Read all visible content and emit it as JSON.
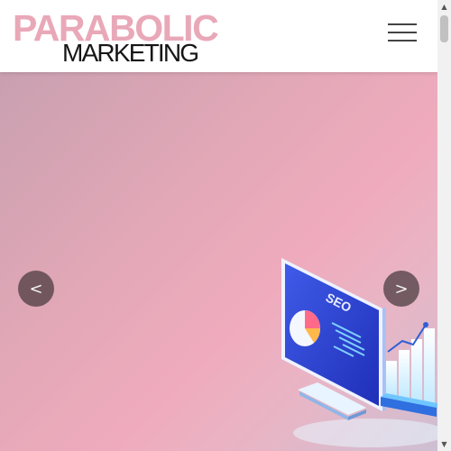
{
  "header": {
    "logo_top": "PARABOLIC",
    "logo_bottom": "MARKETING",
    "menu_icon": "hamburger-menu-icon"
  },
  "hero": {
    "prev_label": "<",
    "next_label": ">",
    "illustration_text": "SEO"
  },
  "scrollbar": {
    "up_glyph": "▲",
    "down_glyph": "▼"
  },
  "colors": {
    "logo_accent": "#e9a8b8",
    "logo_dark": "#161616",
    "hero_pink": "#efabbd",
    "nav_button": "#46373c"
  }
}
